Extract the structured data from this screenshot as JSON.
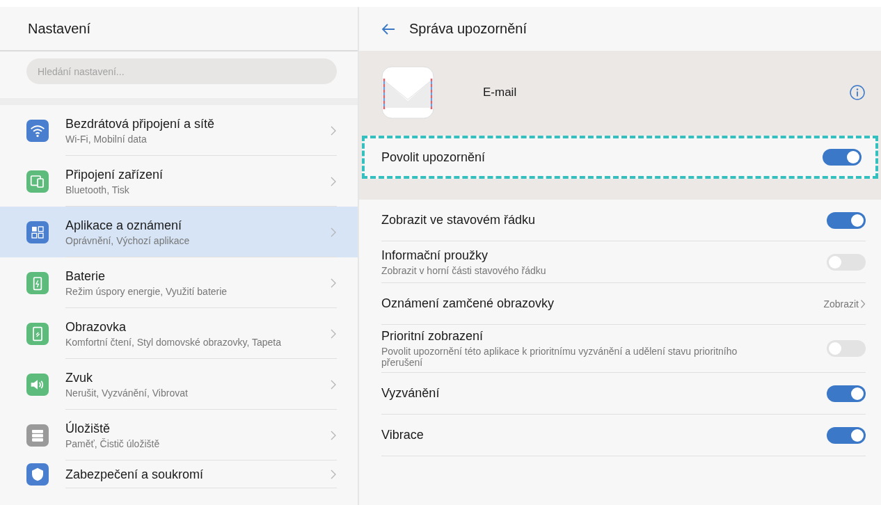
{
  "sidebar": {
    "title": "Nastavení",
    "search": {
      "placeholder": "Hledání nastavení..."
    },
    "items": [
      {
        "title": "Bezdrátová připojení a sítě",
        "subtitle": "Wi-Fi, Mobilní data",
        "color": "#4a7fcf",
        "selected": false
      },
      {
        "title": "Připojení zařízení",
        "subtitle": "Bluetooth, Tisk",
        "color": "#5dbb7c",
        "selected": false
      },
      {
        "title": "Aplikace a oznámení",
        "subtitle": "Oprávnění, Výchozí aplikace",
        "color": "#4a7fcf",
        "selected": true
      },
      {
        "title": "Baterie",
        "subtitle": "Režim úspory energie, Využití baterie",
        "color": "#5dbb7c",
        "selected": false
      },
      {
        "title": "Obrazovka",
        "subtitle": "Komfortní čtení, Styl domovské obrazovky, Tapeta",
        "color": "#5dbb7c",
        "selected": false
      },
      {
        "title": "Zvuk",
        "subtitle": "Nerušit, Vyzvánění, Vibrovat",
        "color": "#5dbb7c",
        "selected": false
      },
      {
        "title": "Úložiště",
        "subtitle": "Paměť, Čistič úložiště",
        "color": "#9a9a9a",
        "selected": false
      },
      {
        "title": "Zabezpečení a soukromí",
        "color": "#4a7fcf",
        "selected": false
      }
    ]
  },
  "panel": {
    "title": "Správa upozornění",
    "app_name": "E-mail",
    "main_toggle": {
      "label": "Povolit upozornění",
      "on": true,
      "highlighted": true
    },
    "rows": [
      {
        "kind": "toggle",
        "label": "Zobrazit ve stavovém řádku",
        "on": true
      },
      {
        "kind": "toggle",
        "label": "Informační proužky",
        "subtitle": "Zobrazit v horní části stavového řádku",
        "on": false
      },
      {
        "kind": "value",
        "label": "Oznámení zamčené obrazovky",
        "value": "Zobrazit"
      },
      {
        "kind": "toggle",
        "label": "Prioritní zobrazení",
        "subtitle": "Povolit upozornění této aplikace k prioritnímu vyzvánění a udělení stavu prioritního přerušení",
        "on": false
      },
      {
        "kind": "toggle",
        "label": "Vyzvánění",
        "on": true
      },
      {
        "kind": "toggle",
        "label": "Vibrace",
        "on": true
      }
    ]
  }
}
